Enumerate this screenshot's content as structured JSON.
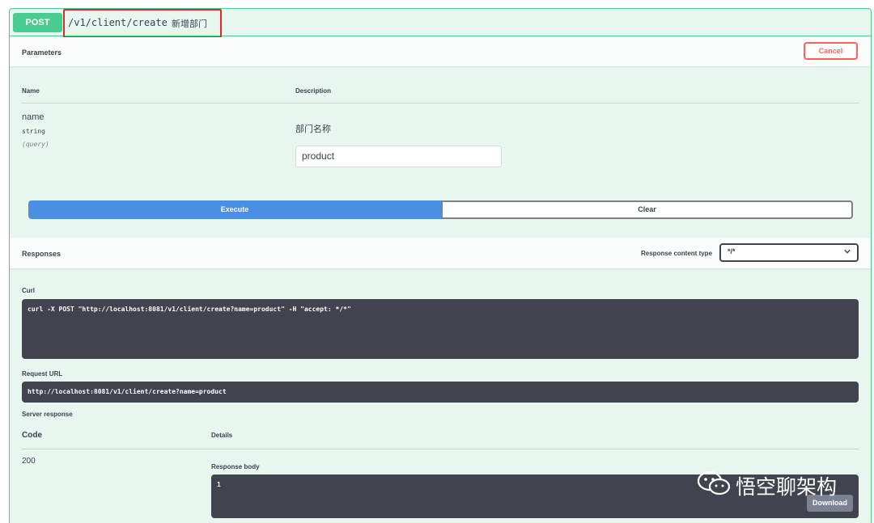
{
  "summary": {
    "method": "POST",
    "path": "/v1/client/create",
    "description": "新增部门"
  },
  "parameters": {
    "title": "Parameters",
    "cancel_label": "Cancel",
    "col_name": "Name",
    "col_description": "Description",
    "param": {
      "name": "name",
      "type": "string",
      "in": "(query)",
      "description": "部门名称",
      "value": "product"
    }
  },
  "actions": {
    "execute_label": "Execute",
    "clear_label": "Clear"
  },
  "responses": {
    "title": "Responses",
    "content_type_label": "Response content type",
    "content_type_value": "*/*",
    "curl_label": "Curl",
    "curl_command": "curl -X POST \"http://localhost:8081/v1/client/create?name=product\" -H \"accept: */*\"",
    "request_url_label": "Request URL",
    "request_url": "http://localhost:8081/v1/client/create?name=product",
    "server_response_label": "Server response",
    "col_code": "Code",
    "col_details": "Details",
    "code": "200",
    "response_body_label": "Response body",
    "response_body": "1",
    "download_label": "Download"
  },
  "watermark": {
    "text": "悟空聊架构",
    "icon": "wechat-icon"
  },
  "colors": {
    "post_green": "#49cc90",
    "execute_blue": "#4990e2",
    "cancel_red": "#ff6060",
    "code_bg": "#41444e",
    "highlight_red": "#e8262a"
  }
}
